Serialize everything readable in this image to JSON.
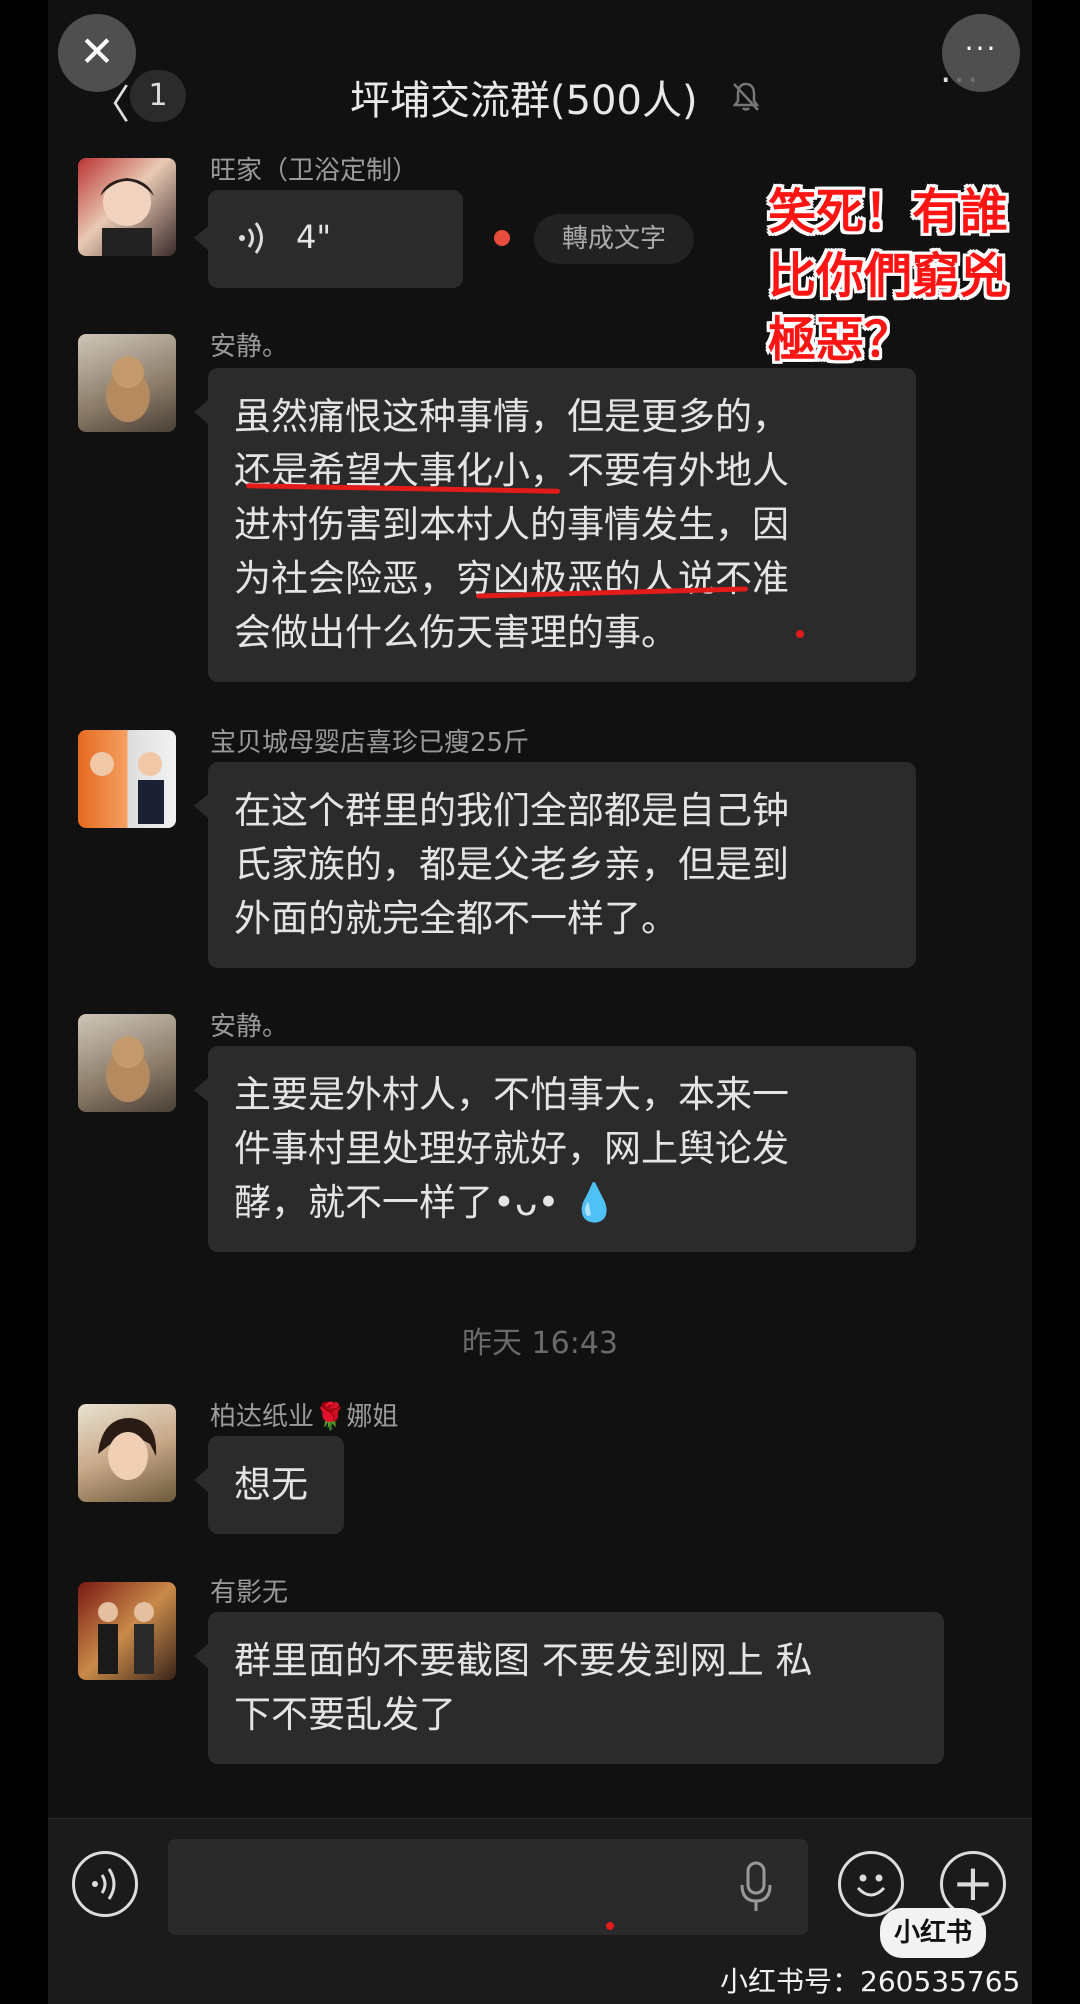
{
  "header": {
    "close_glyph": "✕",
    "more_glyph": "···",
    "back_glyph": "〈",
    "unread_count": "1",
    "title": "坪埔交流群(500人)"
  },
  "messages": [
    {
      "sender": "旺家（卫浴定制）",
      "type": "voice",
      "duration": "4\"",
      "to_text": "轉成文字"
    },
    {
      "sender": "安静。",
      "lines": [
        "虽然痛恨这种事情，但是更多的，",
        "还是希望大事化小，不要有外地人",
        "进村伤害到本村人的事情发生，因",
        "为社会险恶，穷凶极恶的人说不准",
        "会做出什么伤天害理的事。"
      ]
    },
    {
      "sender": "宝贝城母婴店喜珍已瘦25斤",
      "lines": [
        "在这个群里的我们全部都是自己钟",
        "氏家族的，都是父老乡亲，但是到",
        "外面的就完全都不一样了。"
      ]
    },
    {
      "sender": "安静。",
      "lines": [
        "主要是外村人，不怕事大，本来一",
        "件事村里处理好就好，网上舆论发",
        "酵，就不一样了•ᴗ• 💧"
      ]
    },
    {
      "sender": "柏达纸业🌹娜姐",
      "lines": [
        "想无"
      ]
    },
    {
      "sender": "有影无",
      "lines": [
        "群里面的不要截图 不要发到网上  私",
        "下不要乱发了"
      ]
    }
  ],
  "timestamp": "昨天 16:43",
  "overlay": {
    "lines": [
      "笑死！有誰",
      "比你們窮兇",
      "極惡？"
    ]
  },
  "input": {
    "plus_glyph": "+"
  },
  "watermark": {
    "logo": "小红书",
    "id": "小红书号：260535765"
  },
  "colors": {
    "bubble": "#2b2b2b",
    "background": "#111111",
    "annotation_red": "#e21b1b"
  }
}
